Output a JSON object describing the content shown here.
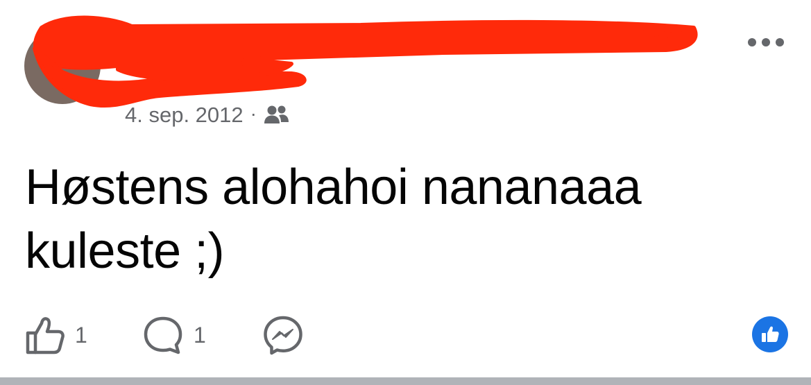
{
  "post": {
    "date": "4. sep. 2012",
    "separator": "·",
    "audience_icon": "friends-icon",
    "more_icon": "more-options-icon",
    "text_line1": "Høstens alohahoi nananaaa",
    "text_line2": "kuleste ;)"
  },
  "actions": {
    "like_count": "1",
    "comment_count": "1",
    "like_icon": "thumbs-up-outline-icon",
    "comment_icon": "comment-bubble-icon",
    "share_icon": "messenger-icon"
  },
  "reactions": {
    "icon": "like-reaction-icon",
    "color": "#1b74e4"
  },
  "colors": {
    "redaction": "#ff2a0a",
    "meta_text": "#65676b",
    "icon_gray": "#65676b",
    "body_text": "#050505"
  }
}
